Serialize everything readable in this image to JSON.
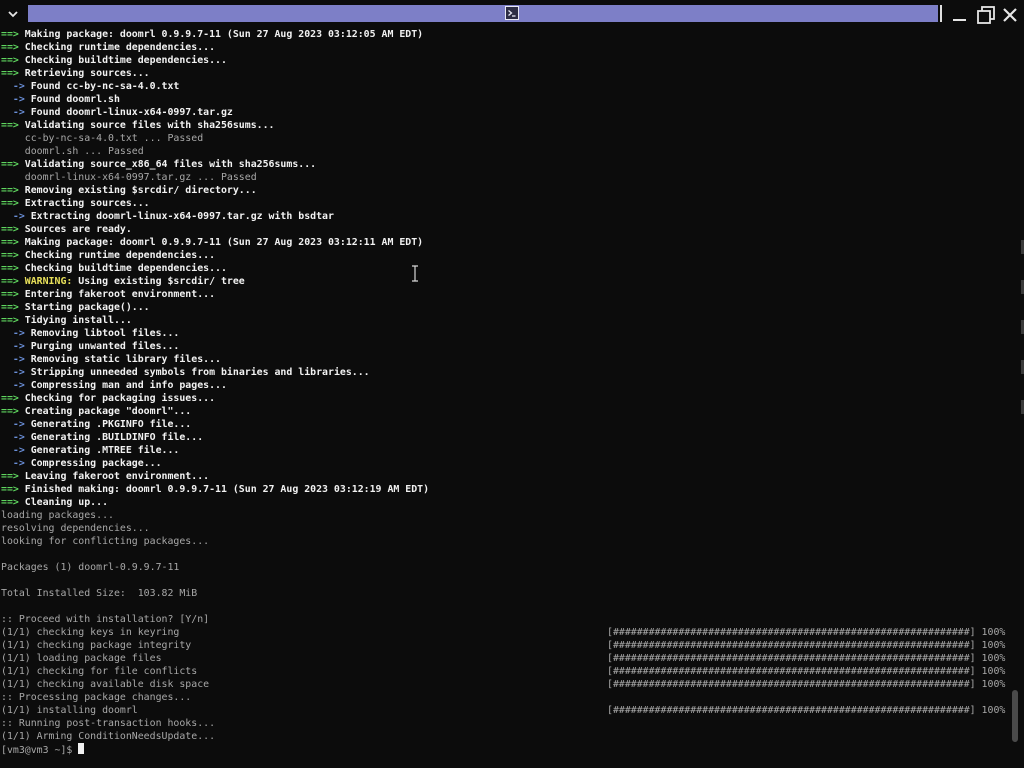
{
  "window": {
    "menu_icon": "chevron-down-icon",
    "title_icon": "terminal-icon",
    "controls": [
      "minimize-icon",
      "maximize-icon",
      "close-icon"
    ]
  },
  "colors": {
    "background": "#0c0c0c",
    "title_strip": "#7d7fc7",
    "arrow_green": "#5fd65f",
    "sub_blue": "#6a8fd8",
    "warning_yellow": "#e8e05a",
    "text_gray": "#a8a8a8",
    "text_bold": "#f2f2f2"
  },
  "terminal": {
    "lines": [
      {
        "k": "a",
        "t": "Making package: doomrl 0.9.9.7-11 (Sun 27 Aug 2023 03:12:05 AM EDT)"
      },
      {
        "k": "a",
        "t": "Checking runtime dependencies..."
      },
      {
        "k": "a",
        "t": "Checking buildtime dependencies..."
      },
      {
        "k": "a",
        "t": "Retrieving sources..."
      },
      {
        "k": "s",
        "t": "Found cc-by-nc-sa-4.0.txt"
      },
      {
        "k": "s",
        "t": "Found doomrl.sh"
      },
      {
        "k": "s",
        "t": "Found doomrl-linux-x64-0997.tar.gz"
      },
      {
        "k": "a",
        "t": "Validating source files with sha256sums..."
      },
      {
        "k": "p",
        "t": "    cc-by-nc-sa-4.0.txt ... Passed"
      },
      {
        "k": "p",
        "t": "    doomrl.sh ... Passed"
      },
      {
        "k": "a",
        "t": "Validating source_x86_64 files with sha256sums..."
      },
      {
        "k": "p",
        "t": "    doomrl-linux-x64-0997.tar.gz ... Passed"
      },
      {
        "k": "a",
        "t": "Removing existing $srcdir/ directory..."
      },
      {
        "k": "a",
        "t": "Extracting sources..."
      },
      {
        "k": "s",
        "t": "Extracting doomrl-linux-x64-0997.tar.gz with bsdtar"
      },
      {
        "k": "a",
        "t": "Sources are ready."
      },
      {
        "k": "a",
        "t": "Making package: doomrl 0.9.9.7-11 (Sun 27 Aug 2023 03:12:11 AM EDT)"
      },
      {
        "k": "a",
        "t": "Checking runtime dependencies..."
      },
      {
        "k": "a",
        "t": "Checking buildtime dependencies..."
      },
      {
        "k": "w",
        "w": "WARNING:",
        "t": " Using existing $srcdir/ tree"
      },
      {
        "k": "a",
        "t": "Entering fakeroot environment..."
      },
      {
        "k": "a",
        "t": "Starting package()..."
      },
      {
        "k": "a",
        "t": "Tidying install..."
      },
      {
        "k": "s",
        "t": "Removing libtool files..."
      },
      {
        "k": "s",
        "t": "Purging unwanted files..."
      },
      {
        "k": "s",
        "t": "Removing static library files..."
      },
      {
        "k": "s",
        "t": "Stripping unneeded symbols from binaries and libraries..."
      },
      {
        "k": "s",
        "t": "Compressing man and info pages..."
      },
      {
        "k": "a",
        "t": "Checking for packaging issues..."
      },
      {
        "k": "a",
        "t": "Creating package \"doomrl\"..."
      },
      {
        "k": "s",
        "t": "Generating .PKGINFO file..."
      },
      {
        "k": "s",
        "t": "Generating .BUILDINFO file..."
      },
      {
        "k": "s",
        "t": "Generating .MTREE file..."
      },
      {
        "k": "s",
        "t": "Compressing package..."
      },
      {
        "k": "a",
        "t": "Leaving fakeroot environment..."
      },
      {
        "k": "a",
        "t": "Finished making: doomrl 0.9.9.7-11 (Sun 27 Aug 2023 03:12:19 AM EDT)"
      },
      {
        "k": "a",
        "t": "Cleaning up..."
      },
      {
        "k": "p",
        "t": "loading packages..."
      },
      {
        "k": "p",
        "t": "resolving dependencies..."
      },
      {
        "k": "p",
        "t": "looking for conflicting packages..."
      },
      {
        "k": "p",
        "t": ""
      },
      {
        "k": "p",
        "t": "Packages (1) doomrl-0.9.9.7-11"
      },
      {
        "k": "p",
        "t": ""
      },
      {
        "k": "p",
        "t": "Total Installed Size:  103.82 MiB"
      },
      {
        "k": "p",
        "t": ""
      },
      {
        "k": "p",
        "t": ":: Proceed with installation? [Y/n]"
      },
      {
        "k": "g",
        "t": "(1/1) checking keys in keyring",
        "bar": "[############################################################] 100%"
      },
      {
        "k": "g",
        "t": "(1/1) checking package integrity",
        "bar": "[############################################################] 100%"
      },
      {
        "k": "g",
        "t": "(1/1) loading package files",
        "bar": "[############################################################] 100%"
      },
      {
        "k": "g",
        "t": "(1/1) checking for file conflicts",
        "bar": "[############################################################] 100%"
      },
      {
        "k": "g",
        "t": "(1/1) checking available disk space",
        "bar": "[############################################################] 100%"
      },
      {
        "k": "p",
        "t": ":: Processing package changes..."
      },
      {
        "k": "g",
        "t": "(1/1) installing doomrl",
        "bar": "[############################################################] 100%"
      },
      {
        "k": "p",
        "t": ":: Running post-transaction hooks..."
      },
      {
        "k": "p",
        "t": "(1/1) Arming ConditionNeedsUpdate..."
      }
    ],
    "arrow_prefix": "==> ",
    "sub_prefix": "  -> ",
    "prompt": "[vm3@vm3 ~]$ "
  }
}
